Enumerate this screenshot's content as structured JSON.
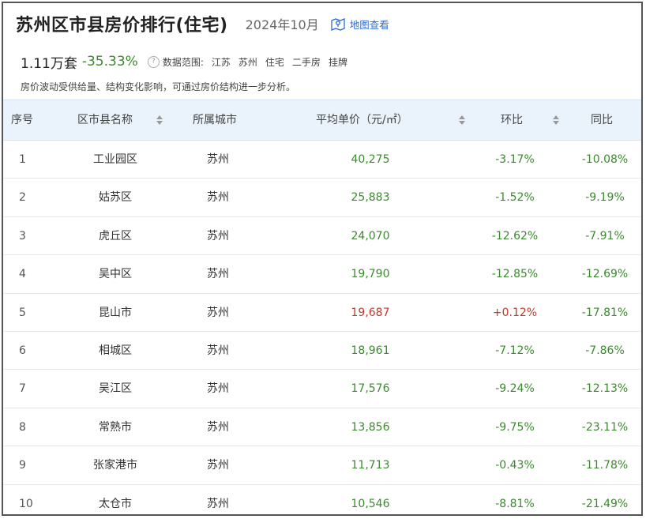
{
  "header": {
    "title": "苏州区市县房价排行(住宅)",
    "date": "2024年10月",
    "map_link_label": "地图查看"
  },
  "summary": {
    "value": "1.11万套",
    "change": "-35.33%",
    "help_glyph": "?",
    "scope_label": "数据范围:",
    "scope_tags": [
      "江苏",
      "苏州",
      "住宅",
      "二手房",
      "挂牌"
    ]
  },
  "note": "房价波动受供给量、结构变化影响，可通过房价结构进一步分析。",
  "table": {
    "headers": {
      "index": "序号",
      "district": "区市县名称",
      "city": "所属城市",
      "price": "平均单价（元/㎡）",
      "mom": "环比",
      "yoy": "同比"
    },
    "rows": [
      {
        "index": "1",
        "district": "工业园区",
        "city": "苏州",
        "price": "40,275",
        "mom": "-3.17%",
        "yoy": "-10.08%",
        "rising": false
      },
      {
        "index": "2",
        "district": "姑苏区",
        "city": "苏州",
        "price": "25,883",
        "mom": "-1.52%",
        "yoy": "-9.19%",
        "rising": false
      },
      {
        "index": "3",
        "district": "虎丘区",
        "city": "苏州",
        "price": "24,070",
        "mom": "-12.62%",
        "yoy": "-7.91%",
        "rising": false
      },
      {
        "index": "4",
        "district": "吴中区",
        "city": "苏州",
        "price": "19,790",
        "mom": "-12.85%",
        "yoy": "-12.69%",
        "rising": false
      },
      {
        "index": "5",
        "district": "昆山市",
        "city": "苏州",
        "price": "19,687",
        "mom": "+0.12%",
        "yoy": "-17.81%",
        "rising": true
      },
      {
        "index": "6",
        "district": "相城区",
        "city": "苏州",
        "price": "18,961",
        "mom": "-7.12%",
        "yoy": "-7.86%",
        "rising": false
      },
      {
        "index": "7",
        "district": "吴江区",
        "city": "苏州",
        "price": "17,576",
        "mom": "-9.24%",
        "yoy": "-12.13%",
        "rising": false
      },
      {
        "index": "8",
        "district": "常熟市",
        "city": "苏州",
        "price": "13,856",
        "mom": "-9.75%",
        "yoy": "-23.11%",
        "rising": false
      },
      {
        "index": "9",
        "district": "张家港市",
        "city": "苏州",
        "price": "11,713",
        "mom": "-0.43%",
        "yoy": "-11.78%",
        "rising": false
      },
      {
        "index": "10",
        "district": "太仓市",
        "city": "苏州",
        "price": "10,546",
        "mom": "-8.81%",
        "yoy": "-21.49%",
        "rising": false
      }
    ]
  },
  "colors": {
    "decline": "#3b8a2e",
    "rise": "#c0392b",
    "header_bg": "#eaf2fb",
    "link": "#2b6cd6"
  }
}
